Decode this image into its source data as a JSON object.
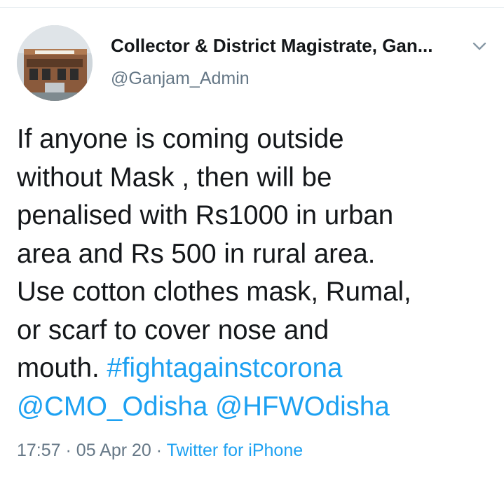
{
  "author": {
    "display_name": "Collector & District Magistrate, Gan...",
    "handle": "@Ganjam_Admin",
    "avatar_icon": "government-building-avatar"
  },
  "tweet": {
    "lines": [
      "If anyone is coming outside",
      "without Mask , then will be",
      "penalised with Rs1000 in urban",
      "area and Rs 500 in rural area.",
      "Use cotton clothes mask, Rumal,",
      "or scarf to cover nose and"
    ],
    "last_line_prefix": "mouth. ",
    "hashtag": "#fightagainstcorona",
    "mention_1": "@CMO_Odisha",
    "mention_2": "@HFWOdisha"
  },
  "meta": {
    "time": "17:57",
    "separator": "·",
    "date": "05 Apr 20",
    "source": "Twitter for iPhone"
  },
  "colors": {
    "link": "#1da1f2",
    "secondary_text": "#657786",
    "primary_text": "#14171a",
    "divider": "#e6ecf0"
  }
}
